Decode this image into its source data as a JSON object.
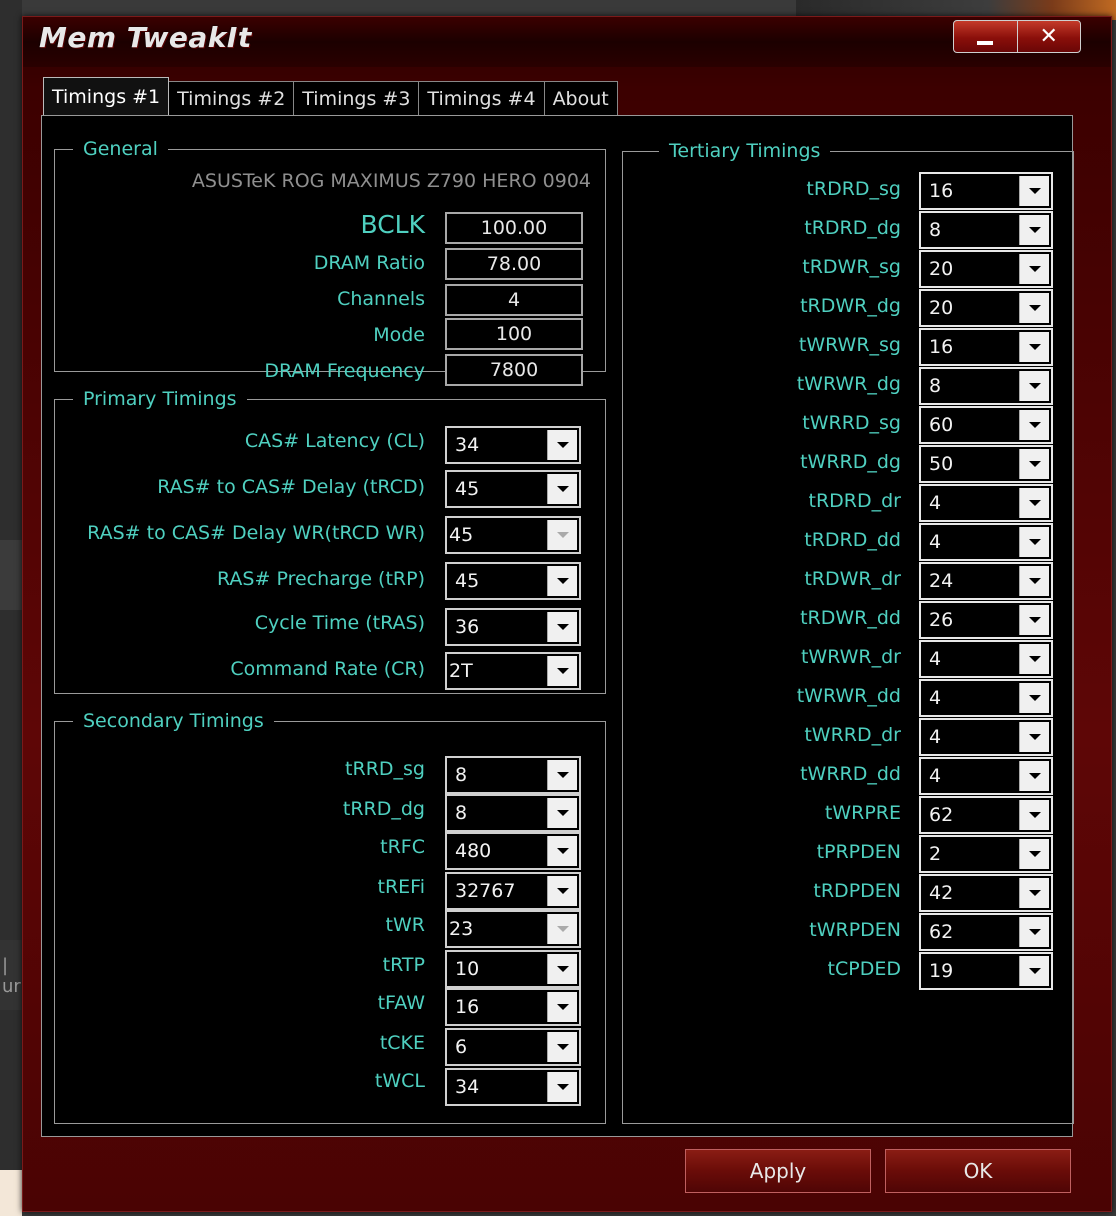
{
  "window": {
    "title": "Mem TweakIt",
    "minimize_label": "",
    "close_label": "✕"
  },
  "tabs": [
    "Timings #1",
    "Timings #2",
    "Timings #3",
    "Timings #4",
    "About"
  ],
  "general": {
    "legend": "General",
    "board": "ASUSTeK ROG MAXIMUS Z790 HERO 0904",
    "fields": [
      {
        "label": "BCLK",
        "value": "100.00"
      },
      {
        "label": "DRAM Ratio",
        "value": "78.00"
      },
      {
        "label": "Channels",
        "value": "4"
      },
      {
        "label": "Mode",
        "value": "100"
      },
      {
        "label": "DRAM Frequency",
        "value": "7800"
      }
    ]
  },
  "primary": {
    "legend": "Primary Timings",
    "fields": [
      {
        "label": "CAS# Latency (CL)",
        "value": "34"
      },
      {
        "label": "RAS# to CAS# Delay (tRCD)",
        "value": "45"
      },
      {
        "label": "RAS# to CAS# Delay WR(tRCD WR)",
        "value": "45"
      },
      {
        "label": "RAS# Precharge (tRP)",
        "value": "45"
      },
      {
        "label": "Cycle Time (tRAS)",
        "value": "36"
      },
      {
        "label": "Command Rate (CR)",
        "value": "2T"
      }
    ]
  },
  "secondary": {
    "legend": "Secondary Timings",
    "fields": [
      {
        "label": "tRRD_sg",
        "value": "8"
      },
      {
        "label": "tRRD_dg",
        "value": "8"
      },
      {
        "label": "tRFC",
        "value": "480"
      },
      {
        "label": "tREFi",
        "value": "32767"
      },
      {
        "label": "tWR",
        "value": "23"
      },
      {
        "label": "tRTP",
        "value": "10"
      },
      {
        "label": "tFAW",
        "value": "16"
      },
      {
        "label": "tCKE",
        "value": "6"
      },
      {
        "label": "tWCL",
        "value": "34"
      }
    ]
  },
  "tertiary": {
    "legend": "Tertiary Timings",
    "fields": [
      {
        "label": "tRDRD_sg",
        "value": "16"
      },
      {
        "label": "tRDRD_dg",
        "value": "8"
      },
      {
        "label": "tRDWR_sg",
        "value": "20"
      },
      {
        "label": "tRDWR_dg",
        "value": "20"
      },
      {
        "label": "tWRWR_sg",
        "value": "16"
      },
      {
        "label": "tWRWR_dg",
        "value": "8"
      },
      {
        "label": "tWRRD_sg",
        "value": "60"
      },
      {
        "label": "tWRRD_dg",
        "value": "50"
      },
      {
        "label": "tRDRD_dr",
        "value": "4"
      },
      {
        "label": "tRDRD_dd",
        "value": "4"
      },
      {
        "label": "tRDWR_dr",
        "value": "24"
      },
      {
        "label": "tRDWR_dd",
        "value": "26"
      },
      {
        "label": "tWRWR_dr",
        "value": "4"
      },
      {
        "label": "tWRWR_dd",
        "value": "4"
      },
      {
        "label": "tWRRD_dr",
        "value": "4"
      },
      {
        "label": "tWRRD_dd",
        "value": "4"
      },
      {
        "label": "tWRPRE",
        "value": "62"
      },
      {
        "label": "tPRPDEN",
        "value": "2"
      },
      {
        "label": "tRDPDEN",
        "value": "42"
      },
      {
        "label": "tWRPDEN",
        "value": "62"
      },
      {
        "label": "tCPDED",
        "value": "19"
      }
    ]
  },
  "buttons": {
    "apply": "Apply",
    "ok": "OK"
  },
  "desktop": {
    "fragment": "| ur"
  }
}
